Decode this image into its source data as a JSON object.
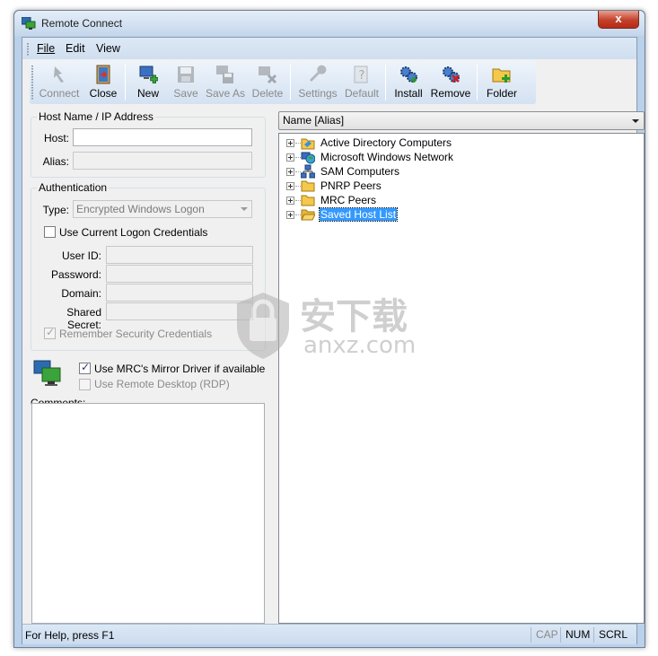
{
  "window": {
    "title": "Remote Connect",
    "close_glyph": "x"
  },
  "menu": {
    "items": [
      {
        "label": "File"
      },
      {
        "label": "Edit"
      },
      {
        "label": "View"
      }
    ]
  },
  "toolbar": {
    "buttons": [
      {
        "label": "Connect",
        "icon": "connect-icon",
        "enabled": false
      },
      {
        "label": "Close",
        "icon": "door-close-icon",
        "enabled": true
      },
      {
        "label": "New",
        "icon": "new-computer-icon",
        "enabled": true
      },
      {
        "label": "Save",
        "icon": "floppy-save-icon",
        "enabled": false
      },
      {
        "label": "Save As",
        "icon": "save-as-icon",
        "enabled": false
      },
      {
        "label": "Delete",
        "icon": "delete-icon",
        "enabled": false
      },
      {
        "label": "Settings",
        "icon": "wrench-icon",
        "enabled": false
      },
      {
        "label": "Default",
        "icon": "default-icon",
        "enabled": false
      },
      {
        "label": "Install",
        "icon": "gears-install-icon",
        "enabled": true
      },
      {
        "label": "Remove",
        "icon": "gears-remove-icon",
        "enabled": true
      },
      {
        "label": "Folder",
        "icon": "new-folder-icon",
        "enabled": true
      }
    ]
  },
  "host": {
    "group_title": "Host Name / IP Address",
    "host_label": "Host:",
    "host_value": "",
    "alias_label": "Alias:",
    "alias_value": ""
  },
  "auth": {
    "group_title": "Authentication",
    "type_label": "Type:",
    "type_value": "Encrypted Windows Logon",
    "use_current_label": "Use Current Logon Credentials",
    "use_current_checked": false,
    "user_id_label": "User ID:",
    "password_label": "Password:",
    "domain_label": "Domain:",
    "shared_secret_label": "Shared Secret:",
    "remember_label": "Remember Security Credentials",
    "remember_checked": true
  },
  "options": {
    "mirror_label": "Use MRC's Mirror Driver if available",
    "mirror_checked": true,
    "rdp_label": "Use Remote Desktop (RDP)",
    "rdp_checked": false
  },
  "comments": {
    "label": "Comments:",
    "value": ""
  },
  "tree": {
    "header": "Name [Alias]",
    "nodes": [
      {
        "label": "Active Directory Computers",
        "icon": "active-directory-icon",
        "selected": false
      },
      {
        "label": "Microsoft Windows Network",
        "icon": "network-globe-icon",
        "selected": false
      },
      {
        "label": "SAM Computers",
        "icon": "sam-network-icon",
        "selected": false
      },
      {
        "label": "PNRP Peers",
        "icon": "folder-icon",
        "selected": false
      },
      {
        "label": "MRC Peers",
        "icon": "folder-icon",
        "selected": false
      },
      {
        "label": "Saved Host List",
        "icon": "open-folder-icon",
        "selected": true
      }
    ]
  },
  "status": {
    "help": "For Help, press F1",
    "cap": "CAP",
    "num": "NUM",
    "scrl": "SCRL"
  },
  "watermark": {
    "text_cn": "安下载",
    "text_en": "anxz.com"
  },
  "colors": {
    "selection": "#3399ff",
    "frame": "#b9d1ea",
    "close_button": "#c4402a"
  }
}
